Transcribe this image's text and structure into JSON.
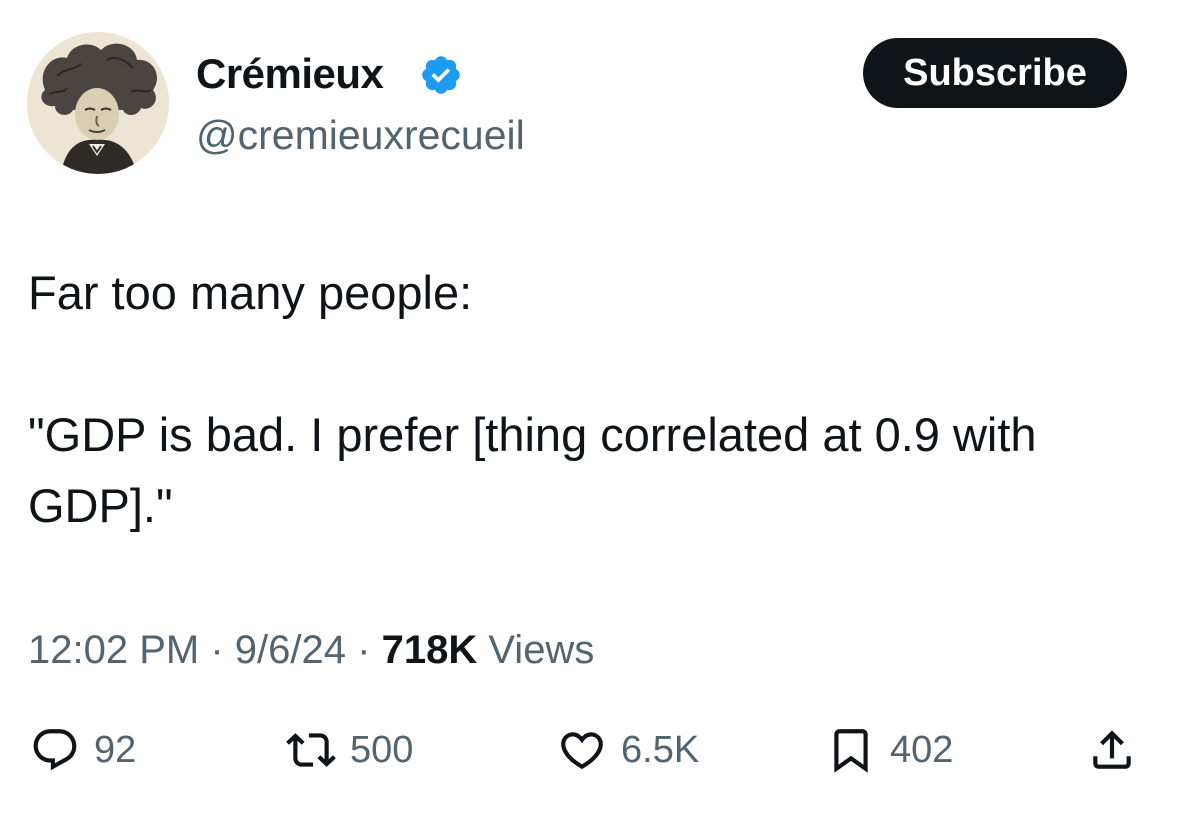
{
  "author": {
    "name": "Crémieux",
    "handle": "@cremieuxrecueil",
    "verified": true,
    "verified_color": "#1d9bf0"
  },
  "subscribe_label": "Subscribe",
  "tweet": {
    "line1": "Far too many people:",
    "line2": "\"GDP is bad. I prefer [thing correlated at 0.9 with GDP].\""
  },
  "meta": {
    "time": "12:02 PM",
    "separator": "·",
    "date": "9/6/24",
    "views_count": "718K",
    "views_label": "Views"
  },
  "actions": {
    "replies": "92",
    "reposts": "500",
    "likes": "6.5K",
    "bookmarks": "402"
  },
  "icons": {
    "reply": "reply-icon",
    "repost": "repost-icon",
    "like": "heart-icon",
    "bookmark": "bookmark-icon",
    "share": "share-icon"
  },
  "colors": {
    "text": "#0f1419",
    "secondary": "#536471",
    "button_bg": "#0f1419"
  }
}
